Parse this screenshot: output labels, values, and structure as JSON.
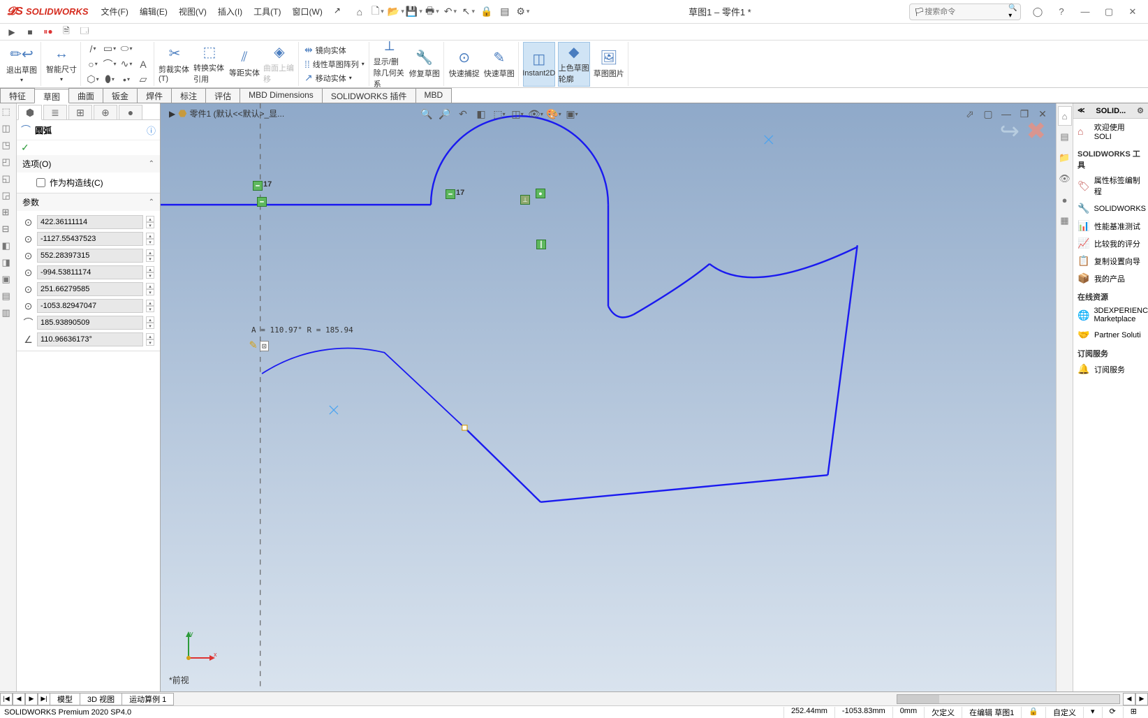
{
  "app": {
    "logo": "SOLIDWORKS",
    "title": "草图1 – 零件1 *"
  },
  "menus": [
    "文件(F)",
    "编辑(E)",
    "视图(V)",
    "插入(I)",
    "工具(T)",
    "窗口(W)"
  ],
  "search": {
    "placeholder": "搜索命令"
  },
  "ribbon": {
    "exitSketch": "退出草图",
    "smartDim": "智能尺寸",
    "trim": "剪裁实体(T)",
    "convert": "转换实体引用",
    "offset": "等距实体",
    "surface": "曲面上编移",
    "mirror": "镜向实体",
    "linearPattern": "线性草图阵列",
    "moveEntity": "移动实体",
    "showRel": "显示/删除几何关系",
    "repair": "修复草图",
    "quickSnap": "快速捕捉",
    "rapidSketch": "快速草图",
    "instant2d": "Instant2D",
    "shaded": "上色草图轮廓",
    "sketchPic": "草图图片"
  },
  "cmdTabs": [
    "特征",
    "草图",
    "曲面",
    "钣金",
    "焊件",
    "标注",
    "评估",
    "MBD Dimensions",
    "SOLIDWORKS 插件",
    "MBD"
  ],
  "breadcrumb": "零件1   (默认<<默认>_显...",
  "prop": {
    "title": "圆弧",
    "opt_head": "选项(O)",
    "construction": "作为构造线(C)",
    "param_head": "参数",
    "params": [
      "422.36111114",
      "-1127.55437523",
      "552.28397315",
      "-994.53811174",
      "251.66279585",
      "-1053.82947047",
      "185.93890509",
      "110.96636173°"
    ]
  },
  "canvas": {
    "angleLabel": "A = 110.97°  R = 185.94",
    "rel17a": "17",
    "rel17b": "17",
    "viewLabel": "*前视"
  },
  "taskPane": {
    "head": "SOLID...",
    "welcome": "欢迎使用  SOLI",
    "sec1": "SOLIDWORKS 工具",
    "items1": [
      "属性标签编制程",
      "SOLIDWORKS",
      "性能基准测试",
      "比较我的评分",
      "复制设置向导",
      "我的产品"
    ],
    "sec2": "在线资源",
    "items2": [
      "3DEXPERIENC Marketplace",
      "Partner Soluti"
    ],
    "sec3": "订阅服务",
    "items3": [
      "订阅服务"
    ]
  },
  "bottomTabs": [
    "模型",
    "3D 视图",
    "运动算例 1"
  ],
  "status": {
    "product": "SOLIDWORKS Premium 2020 SP4.0",
    "x": "252.44mm",
    "y": "-1053.83mm",
    "z": "0mm",
    "underdef": "欠定义",
    "editing": "在编辑 草图1",
    "custom": "自定义"
  }
}
